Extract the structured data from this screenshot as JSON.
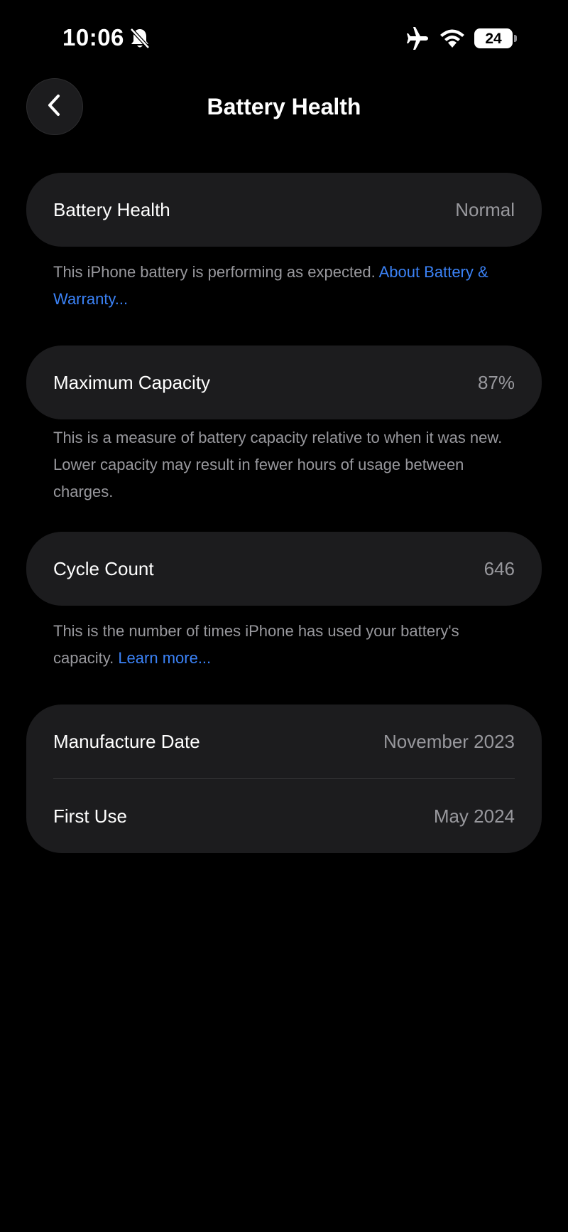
{
  "status_bar": {
    "time": "10:06",
    "battery_level": "24",
    "icons": [
      "bell-slash-icon",
      "airplane-icon",
      "wifi-icon",
      "battery-icon"
    ]
  },
  "nav": {
    "back_icon": "chevron-left-icon",
    "title": "Battery Health"
  },
  "battery_health": {
    "label": "Battery Health",
    "value": "Normal",
    "note_text": "This iPhone battery is performing as expected. ",
    "note_link": "About Battery & Warranty..."
  },
  "maximum_capacity": {
    "label": "Maximum Capacity",
    "value": "87%",
    "note_text": "This is a measure of battery capacity relative to when it was new. Lower capacity may result in fewer hours of usage between charges."
  },
  "cycle_count": {
    "label": "Cycle Count",
    "value": "646",
    "note_text": "This is the number of times iPhone has used your battery's capacity. ",
    "note_link": "Learn more..."
  },
  "dates": {
    "manufacture_label": "Manufacture Date",
    "manufacture_value": "November 2023",
    "first_use_label": "First Use",
    "first_use_value": "May 2024"
  },
  "colors": {
    "background": "#000000",
    "card": "#1c1c1e",
    "secondary_text": "#98989d",
    "link": "#3b82f6"
  }
}
